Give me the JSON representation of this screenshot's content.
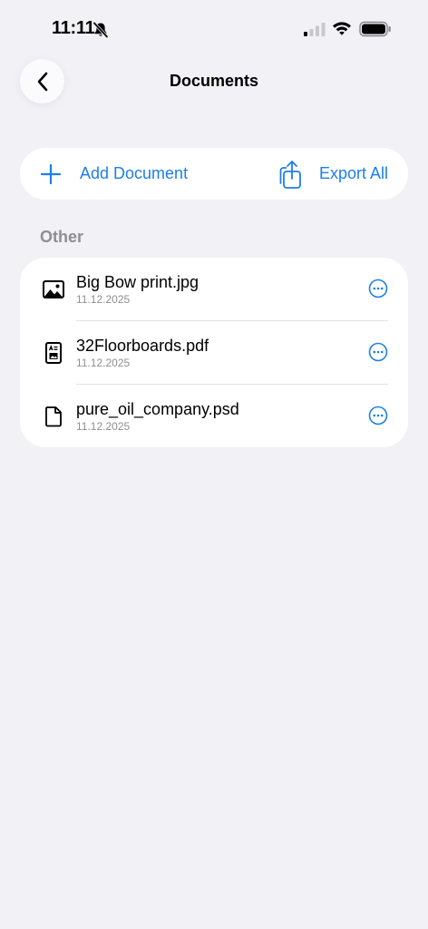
{
  "status_bar": {
    "time": "11:11"
  },
  "header": {
    "title": "Documents"
  },
  "actions": {
    "add_label": "Add Document",
    "export_label": "Export All"
  },
  "section": {
    "title": "Other"
  },
  "files": [
    {
      "name": "Big Bow print.jpg",
      "date": "11.12.2025",
      "icon": "image-icon"
    },
    {
      "name": "32Floorboards.pdf",
      "date": "11.12.2025",
      "icon": "pdf-document-icon"
    },
    {
      "name": "pure_oil_company.psd",
      "date": "11.12.2025",
      "icon": "file-icon"
    }
  ],
  "colors": {
    "accent": "#1d7fe6",
    "background": "#f1f1f6",
    "secondary_text": "#8e8e93"
  }
}
